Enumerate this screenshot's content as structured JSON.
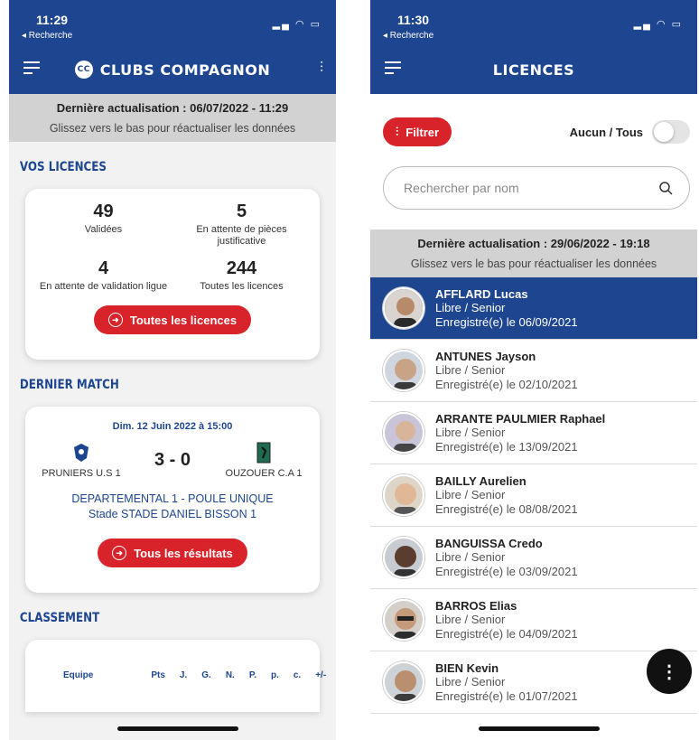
{
  "colors": {
    "brand_blue": "#1e4690",
    "accent_red": "#d8232a",
    "refresh_gray": "#d2d2d2"
  },
  "screen1": {
    "status": {
      "time": "11:29",
      "back": "◂ Recherche"
    },
    "navbar": {
      "logo": "CC",
      "title": "CLUBS COMPAGNON"
    },
    "refresh": {
      "line1": "Dernière actualisation : 06/07/2022 - 11:29",
      "line2": "Glissez vers le bas pour réactualiser les données"
    },
    "licences": {
      "title": "VOS LICENCES",
      "stats": [
        {
          "value": "49",
          "label": "Validées"
        },
        {
          "value": "5",
          "label": "En attente de pièces justificative"
        },
        {
          "value": "4",
          "label": "En attente de validation ligue"
        },
        {
          "value": "244",
          "label": "Toutes les licences"
        }
      ],
      "button": "Toutes les licences"
    },
    "match": {
      "title": "DERNIER MATCH",
      "date": "Dim. 12 Juin 2022 à 15:00",
      "home": "PRUNIERS U.S 1",
      "away": "OUZOUER C.A 1",
      "score": "3 - 0",
      "competition": "DEPARTEMENTAL 1 - POULE UNIQUE",
      "stadium": "Stade STADE DANIEL BISSON 1",
      "button": "Tous les résultats"
    },
    "classement": {
      "title": "CLASSEMENT",
      "headers": [
        "Equipe",
        "Pts",
        "J.",
        "G.",
        "N.",
        "P.",
        "p.",
        "c.",
        "+/-"
      ]
    }
  },
  "screen2": {
    "status": {
      "time": "11:30",
      "back": "◂ Recherche"
    },
    "navbar": {
      "title": "LICENCES"
    },
    "filter_button": "Filtrer",
    "toggle_label": "Aucun / Tous",
    "search": {
      "placeholder": "Rechercher par nom"
    },
    "refresh": {
      "line1": "Dernière actualisation : 29/06/2022 - 19:18",
      "line2": "Glissez vers le bas pour réactualiser les données"
    },
    "players": [
      {
        "name": "AFFLARD Lucas",
        "type": "Libre / Senior",
        "date": "Enregistré(e) le 06/09/2021"
      },
      {
        "name": "ANTUNES Jayson",
        "type": "Libre / Senior",
        "date": "Enregistré(e) le 02/10/2021"
      },
      {
        "name": "ARRANTE PAULMIER Raphael",
        "type": "Libre / Senior",
        "date": "Enregistré(e) le 13/09/2021"
      },
      {
        "name": "BAILLY Aurelien",
        "type": "Libre / Senior",
        "date": "Enregistré(e) le 08/08/2021"
      },
      {
        "name": "BANGUISSA Credo",
        "type": "Libre / Senior",
        "date": "Enregistré(e) le 03/09/2021"
      },
      {
        "name": "BARROS Elias",
        "type": "Libre / Senior",
        "date": "Enregistré(e) le 04/09/2021"
      },
      {
        "name": "BIEN Kevin",
        "type": "Libre / Senior",
        "date": "Enregistré(e) le 01/07/2021"
      }
    ]
  }
}
